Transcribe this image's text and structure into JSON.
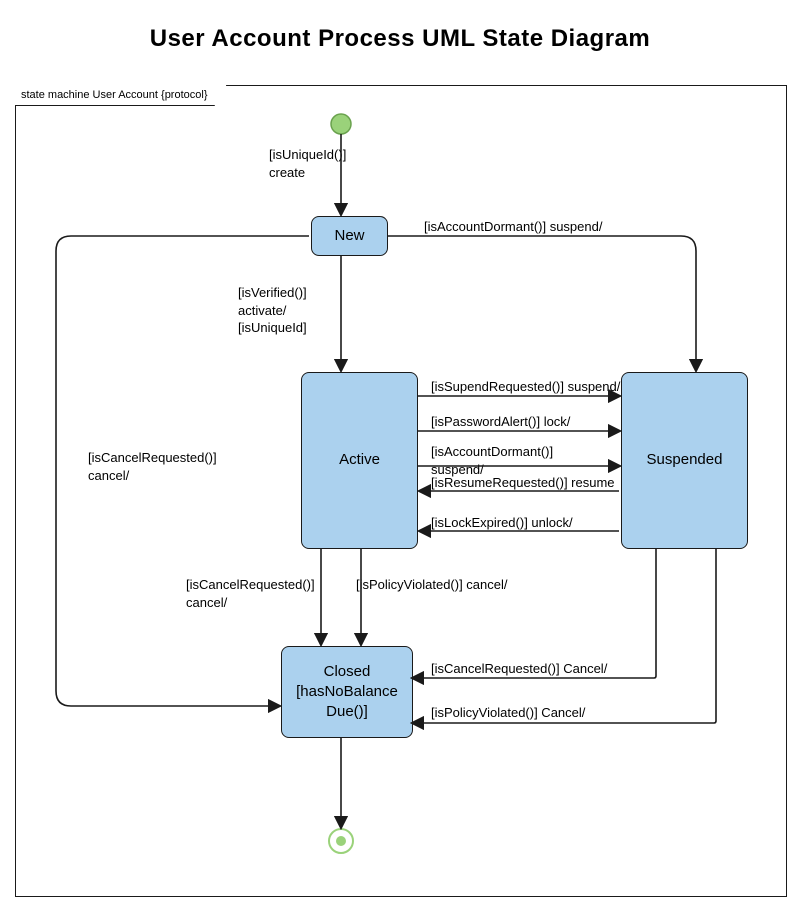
{
  "title": "User Account Process UML State Diagram",
  "frameLabel": "state machine User Account {protocol}",
  "states": {
    "new": "New",
    "active": "Active",
    "suspended": "Suspended",
    "closed": "Closed\n[hasNoBalance\nDue()]"
  },
  "transitions": {
    "init_to_new": "[isUniqueId()]\ncreate",
    "new_to_active": "[isVerified()]\nactivate/\n[isUniqueId]",
    "new_to_suspended": "[isAccountDormant()] suspend/",
    "new_to_closed": "[isCancelRequested()]\ncancel/",
    "active_to_suspended_1": "[isSupendRequested()] suspend/",
    "active_to_suspended_2": "[isPasswordAlert()] lock/",
    "active_to_suspended_3": "[isAccountDormant()]\nsuspend/",
    "suspended_to_active_1": "[isResumeRequested()] resume",
    "suspended_to_active_2": "[isLockExpired()] unlock/",
    "active_to_closed_1": "[isCancelRequested()]\ncancel/",
    "active_to_closed_2": "[isPolicyViolated()] cancel/",
    "suspended_to_closed_1": "[isCancelRequested()] Cancel/",
    "suspended_to_closed_2": "[isPolicyViolated()] Cancel/"
  }
}
